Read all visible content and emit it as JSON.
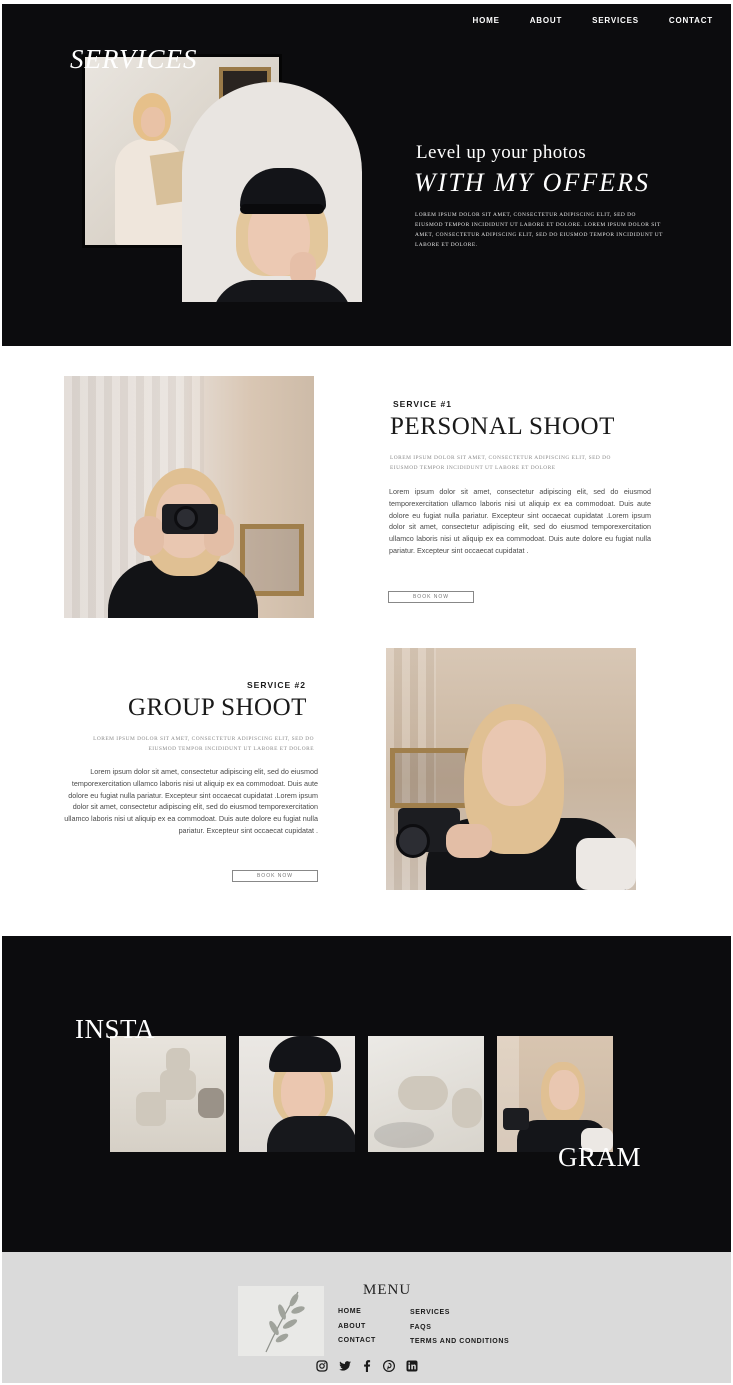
{
  "nav": {
    "items": [
      "HOME",
      "ABOUT",
      "SERVICES",
      "CONTACT"
    ]
  },
  "hero": {
    "overlay_title": "SERVICES",
    "heading": "Level up your photos",
    "subheading": "WITH MY OFFERS",
    "body": "LOREM IPSUM DOLOR SIT AMET, CONSECTETUR ADIPISCING ELIT, SED DO EIUSMOD TEMPOR INCIDIDUNT UT LABORE ET DOLORE. LOREM IPSUM DOLOR SIT AMET, CONSECTETUR ADIPISCING ELIT, SED DO EIUSMOD TEMPOR INCIDIDUNT UT LABORE ET DOLORE."
  },
  "services": [
    {
      "label": "SERVICE #1",
      "title": "PERSONAL SHOOT",
      "subtitle": "LOREM IPSUM DOLOR SIT AMET, CONSECTETUR ADIPISCING ELIT, SED DO EIUSMOD TEMPOR INCIDIDUNT UT LABORE ET DOLORE",
      "body": "Lorem ipsum dolor sit amet, consectetur adipiscing elit, sed do eiusmod temporexercitation ullamco laboris nisi ut aliquip ex ea commodoat. Duis aute dolore eu fugiat nulla pariatur. Excepteur sint occaecat cupidatat .Lorem ipsum dolor sit amet, consectetur adipiscing elit, sed do eiusmod temporexercitation ullamco laboris nisi ut aliquip ex ea commodoat. Duis aute dolore eu fugiat nulla pariatur. Excepteur sint occaecat cupidatat .",
      "button": "BOOK NOW"
    },
    {
      "label": "SERVICE #2",
      "title": "GROUP SHOOT",
      "subtitle": "LOREM IPSUM DOLOR SIT AMET, CONSECTETUR ADIPISCING ELIT, SED DO EIUSMOD TEMPOR INCIDIDUNT UT LABORE ET DOLORE",
      "body": "Lorem ipsum dolor sit amet, consectetur adipiscing elit, sed do eiusmod temporexercitation ullamco laboris nisi ut aliquip ex ea commodoat. Duis aute dolore eu fugiat nulla pariatur. Excepteur sint occaecat cupidatat .Lorem ipsum dolor sit amet, consectetur adipiscing elit, sed do eiusmod temporexercitation ullamco laboris nisi ut aliquip ex ea commodoat. Duis aute dolore eu fugiat nulla pariatur. Excepteur sint occaecat cupidatat .",
      "button": "BOOK NOW"
    }
  ],
  "instagram": {
    "word_left": "INSTA",
    "word_right": "GRAM"
  },
  "footer": {
    "menu_title": "MENU",
    "col1": [
      "HOME",
      "ABOUT",
      "CONTACT"
    ],
    "col2": [
      "SERVICES",
      "FAQS",
      "TERMS AND CONDITIONS"
    ],
    "social_icons": [
      "instagram-icon",
      "twitter-icon",
      "facebook-icon",
      "pinterest-icon",
      "linkedin-icon"
    ]
  },
  "colors": {
    "dark_bg": "#0c0c0e",
    "footer_bg": "#dadada",
    "text_dark": "#1a1a1a"
  }
}
